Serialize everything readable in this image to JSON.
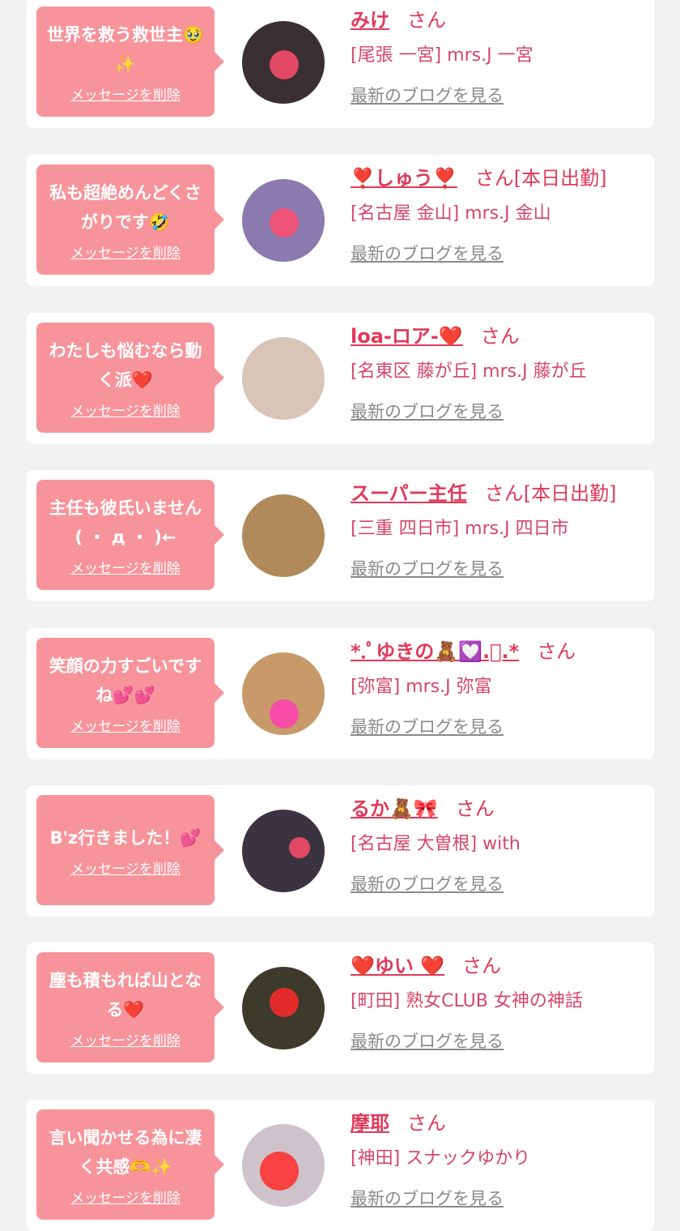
{
  "delete_label": "メッセージを削除",
  "blog_label": "最新のブログを見る",
  "honorific": "さん",
  "colors": {
    "background": "#f2f2f2",
    "bubble": "#f7949b",
    "name": "#e03a5a",
    "shop": "#d6456a",
    "link_gray": "#8a8a8a"
  },
  "items": [
    {
      "message": "世界を救う救世主🥹✨",
      "name": "みけ",
      "status": "",
      "shop": "[尾張 一宮] mrs.J 一宮",
      "avatar_color": "#3a3033"
    },
    {
      "message": "私も超絶めんどくさがりです🤣",
      "name": "❣️しゅう❣️",
      "status": "[本日出勤]",
      "shop": "[名古屋 金山] mrs.J 金山",
      "avatar_color": "#8a7ab0"
    },
    {
      "message": "わたしも悩むなら動く派❤️",
      "name": "loa-ロア-❤️",
      "status": "",
      "shop": "[名東区 藤が丘] mrs.J 藤が丘",
      "avatar_color": "#d9c4b8"
    },
    {
      "message": "主任も彼氏いません( ・ д ・ )←",
      "name": "スーパー主任",
      "status": "[本日出勤]",
      "shop": "[三重 四日市] mrs.J 四日市",
      "avatar_color": "#b08a5a"
    },
    {
      "message": "笑顔の力すごいですね💕💕",
      "name": "*.ﾟゆきの🧸💟.ﾟ.*",
      "status": "",
      "shop": "[弥富] mrs.J 弥富",
      "avatar_color": "#c89a6a"
    },
    {
      "message": "B'z行きました！💕",
      "name": "るか🧸🎀",
      "status": "",
      "shop": "[名古屋 大曽根] with",
      "avatar_color": "#3b3440"
    },
    {
      "message": "塵も積もれば山となる❤️",
      "name": "❤️ゆい ❤️",
      "status": "",
      "shop": "[町田] 熟女CLUB 女神の神話",
      "avatar_color": "#3d3a2c"
    },
    {
      "message": "言い聞かせる為に凄く共感🫶✨",
      "name": "摩耶",
      "status": "",
      "shop": "[神田] スナックゆかり",
      "avatar_color": "#cfc3cb"
    }
  ]
}
